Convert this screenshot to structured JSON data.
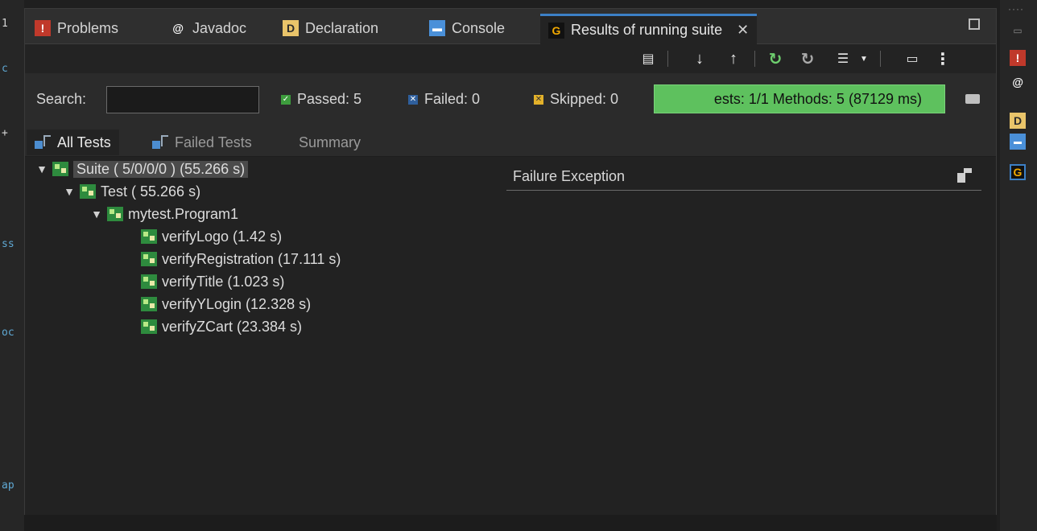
{
  "tabs": [
    {
      "label": "Problems",
      "icon": "problems-icon"
    },
    {
      "label": "Javadoc",
      "icon": "javadoc-icon"
    },
    {
      "label": "Declaration",
      "icon": "declaration-icon"
    },
    {
      "label": "Console",
      "icon": "console-icon"
    },
    {
      "label": "Results of running suite",
      "icon": "testng-icon",
      "active": true
    }
  ],
  "left_gutter_chars": [
    "1",
    "c",
    "+",
    "ss",
    "oc",
    "ap"
  ],
  "status": {
    "search_label": "Search:",
    "search_value": "",
    "passed": "Passed: 5",
    "failed": "Failed: 0",
    "skipped": "Skipped: 0",
    "progress_text": "ests: 1/1  Methods: 5 (87129 ms)",
    "progress_color": "#5ec15e"
  },
  "subtabs": [
    "All Tests",
    "Failed Tests",
    "Summary"
  ],
  "tree": [
    {
      "label": "Suite ( 5/0/0/0 ) (55.266 s)",
      "level": 0,
      "expanded": true,
      "selected": true
    },
    {
      "label": "Test ( 55.266 s)",
      "level": 1,
      "expanded": true
    },
    {
      "label": "mytest.Program1",
      "level": 2,
      "expanded": true
    },
    {
      "label": "verifyLogo  (1.42 s)",
      "level": 3
    },
    {
      "label": "verifyRegistration  (17.111 s)",
      "level": 3
    },
    {
      "label": "verifyTitle  (1.023 s)",
      "level": 3
    },
    {
      "label": "verifyYLogin  (12.328 s)",
      "level": 3
    },
    {
      "label": "verifyZCart  (23.384 s)",
      "level": 3
    }
  ],
  "failure_panel": {
    "title": "Failure Exception"
  },
  "colors": {
    "accent": "#3c80c6",
    "pass": "#3d9d3d",
    "skip": "#e3b12a"
  }
}
